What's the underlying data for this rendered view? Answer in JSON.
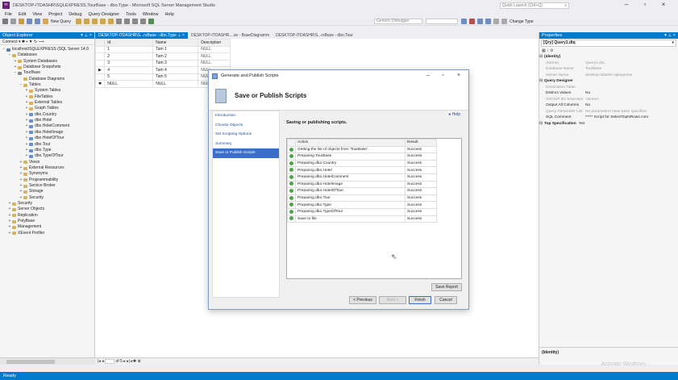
{
  "window": {
    "title": "DESKTOP-ITDASHR\\SQLEXPRESS.TourBase - dbo.Type - Microsoft SQL Server Management Studio",
    "quick_launch": "Quick Launch (Ctrl+Q)"
  },
  "menu": [
    "File",
    "Edit",
    "View",
    "Project",
    "Debug",
    "Query Designer",
    "Tools",
    "Window",
    "Help"
  ],
  "toolbar": {
    "new_query": "New Query",
    "debugger": "Generic Debugger",
    "change_type": "Change Type"
  },
  "object_explorer": {
    "title": "Object Explorer",
    "connect": "Connect",
    "tree": [
      {
        "label": "localhost\\SQLEXPRESS (SQL Server 14.0",
        "indent": 0,
        "icon": "srv",
        "exp": "−"
      },
      {
        "label": "Databases",
        "indent": 1,
        "icon": "folder",
        "exp": "−"
      },
      {
        "label": "System Databases",
        "indent": 2,
        "icon": "folder",
        "exp": "+"
      },
      {
        "label": "Database Snapshots",
        "indent": 2,
        "icon": "folder",
        "exp": "+"
      },
      {
        "label": "TourBase",
        "indent": 2,
        "icon": "db",
        "exp": "−"
      },
      {
        "label": "Database Diagrams",
        "indent": 3,
        "icon": "folder",
        "exp": ""
      },
      {
        "label": "Tables",
        "indent": 3,
        "icon": "folder",
        "exp": "−"
      },
      {
        "label": "System Tables",
        "indent": 4,
        "icon": "folder",
        "exp": "+"
      },
      {
        "label": "FileTables",
        "indent": 4,
        "icon": "folder",
        "exp": "+"
      },
      {
        "label": "External Tables",
        "indent": 4,
        "icon": "folder",
        "exp": "+"
      },
      {
        "label": "Graph Tables",
        "indent": 4,
        "icon": "folder",
        "exp": "+"
      },
      {
        "label": "dbo.Country",
        "indent": 4,
        "icon": "table",
        "exp": "+"
      },
      {
        "label": "dbo.Hotel",
        "indent": 4,
        "icon": "table",
        "exp": "+"
      },
      {
        "label": "dbo.HotelComment",
        "indent": 4,
        "icon": "table",
        "exp": "+"
      },
      {
        "label": "dbo.HotelImage",
        "indent": 4,
        "icon": "table",
        "exp": "+"
      },
      {
        "label": "dbo.HotelOfTour",
        "indent": 4,
        "icon": "table",
        "exp": "+"
      },
      {
        "label": "dbo.Tour",
        "indent": 4,
        "icon": "table",
        "exp": "+"
      },
      {
        "label": "dbo.Type",
        "indent": 4,
        "icon": "table",
        "exp": "+"
      },
      {
        "label": "dbo.TypeOfTour",
        "indent": 4,
        "icon": "table",
        "exp": "+"
      },
      {
        "label": "Views",
        "indent": 3,
        "icon": "folder",
        "exp": "+"
      },
      {
        "label": "External Resources",
        "indent": 3,
        "icon": "folder",
        "exp": "+"
      },
      {
        "label": "Synonyms",
        "indent": 3,
        "icon": "folder",
        "exp": "+"
      },
      {
        "label": "Programmability",
        "indent": 3,
        "icon": "folder",
        "exp": "+"
      },
      {
        "label": "Service Broker",
        "indent": 3,
        "icon": "folder",
        "exp": "+"
      },
      {
        "label": "Storage",
        "indent": 3,
        "icon": "folder",
        "exp": "+"
      },
      {
        "label": "Security",
        "indent": 3,
        "icon": "folder",
        "exp": "+"
      },
      {
        "label": "Security",
        "indent": 1,
        "icon": "folder",
        "exp": "+"
      },
      {
        "label": "Server Objects",
        "indent": 1,
        "icon": "folder",
        "exp": "+"
      },
      {
        "label": "Replication",
        "indent": 1,
        "icon": "folder",
        "exp": "+"
      },
      {
        "label": "PolyBase",
        "indent": 1,
        "icon": "folder",
        "exp": "+"
      },
      {
        "label": "Management",
        "indent": 1,
        "icon": "folder",
        "exp": "+"
      },
      {
        "label": "XEvent Profiler",
        "indent": 1,
        "icon": "folder",
        "exp": "+"
      }
    ]
  },
  "doc_tabs": [
    "DESKTOP-ITDASHR\\S...rsBase - dbo.Type",
    "DESKTOP-ITDASHR....se - BaseDiagramm",
    "DESKTOP-ITDASHR\\S...rsBase - dbo.Tour"
  ],
  "grid": {
    "columns": [
      "Id",
      "Name",
      "Description"
    ],
    "rows": [
      {
        "marker": "",
        "id": "1",
        "name": "Tam 1",
        "desc": "NULL"
      },
      {
        "marker": "",
        "id": "2",
        "name": "Tam 2",
        "desc": "NULL"
      },
      {
        "marker": "",
        "id": "3",
        "name": "Tam 3",
        "desc": "NULL"
      },
      {
        "marker": "▶",
        "id": "4",
        "name": "Tam 4",
        "desc": "NULL"
      },
      {
        "marker": "",
        "id": "5",
        "name": "Tam 5",
        "desc": "NULL"
      },
      {
        "marker": "✱",
        "id": "NULL",
        "name": "NULL",
        "desc": "NULL"
      }
    ],
    "nav": "of 5"
  },
  "dialog": {
    "title": "Generate and Publish Scripts",
    "heading": "Save or Publish Scripts",
    "help": "Help",
    "nav": [
      "Introduction",
      "Choose Objects",
      "Set Scripting Options",
      "Summary",
      "Save or Publish Scripts"
    ],
    "status": "Saving or publishing scripts.",
    "columns": [
      "Action",
      "Result"
    ],
    "actions": [
      {
        "action": "Getting the list of objects from 'TourBase'.",
        "result": "Success"
      },
      {
        "action": "Preparing TourBase",
        "result": "Success"
      },
      {
        "action": "Preparing dbo.Country",
        "result": "Success"
      },
      {
        "action": "Preparing dbo.Hotel",
        "result": "Success"
      },
      {
        "action": "Preparing dbo.HotelComment",
        "result": "Success"
      },
      {
        "action": "Preparing dbo.HotelImage",
        "result": "Success"
      },
      {
        "action": "Preparing dbo.HotelOfTour",
        "result": "Success"
      },
      {
        "action": "Preparing dbo.Tour",
        "result": "Success"
      },
      {
        "action": "Preparing dbo.Type",
        "result": "Success"
      },
      {
        "action": "Preparing dbo.TypeOfTour",
        "result": "Success"
      },
      {
        "action": "Save to file",
        "result": "Success"
      }
    ],
    "save_report": "Save Report",
    "previous": "< Previous",
    "next": "Next >",
    "finish": "Finish",
    "cancel": "Cancel"
  },
  "properties": {
    "title": "Properties",
    "object": "[Qry] Query1.dtq",
    "rows": [
      {
        "k": "(Identity)",
        "v": "",
        "type": "cat"
      },
      {
        "k": "(Name)",
        "v": "Query1.dtq",
        "type": "dim"
      },
      {
        "k": "Database Name",
        "v": "TourBase",
        "type": "dim"
      },
      {
        "k": "Server Name",
        "v": "desktop-itdashh.sqlexpress",
        "type": "dim"
      },
      {
        "k": "Query Designer",
        "v": "",
        "type": "cat"
      },
      {
        "k": "Destination Table",
        "v": "",
        "type": "dim"
      },
      {
        "k": "Distinct Values",
        "v": "No",
        "type": ""
      },
      {
        "k": "GROUP BY Extension",
        "v": "<None>",
        "type": "dim"
      },
      {
        "k": "Output All Columns",
        "v": "No",
        "type": ""
      },
      {
        "k": "Query Parameter List",
        "v": "No parameters have been specified",
        "type": "dim"
      },
      {
        "k": "SQL Comment",
        "v": "***** Script for SelectTopNRows com",
        "type": ""
      },
      {
        "k": "Top Specification",
        "v": "Yes",
        "type": "cat"
      }
    ],
    "desc": "(Identity)"
  },
  "status": "Ready",
  "watermark": "Activate Windows"
}
